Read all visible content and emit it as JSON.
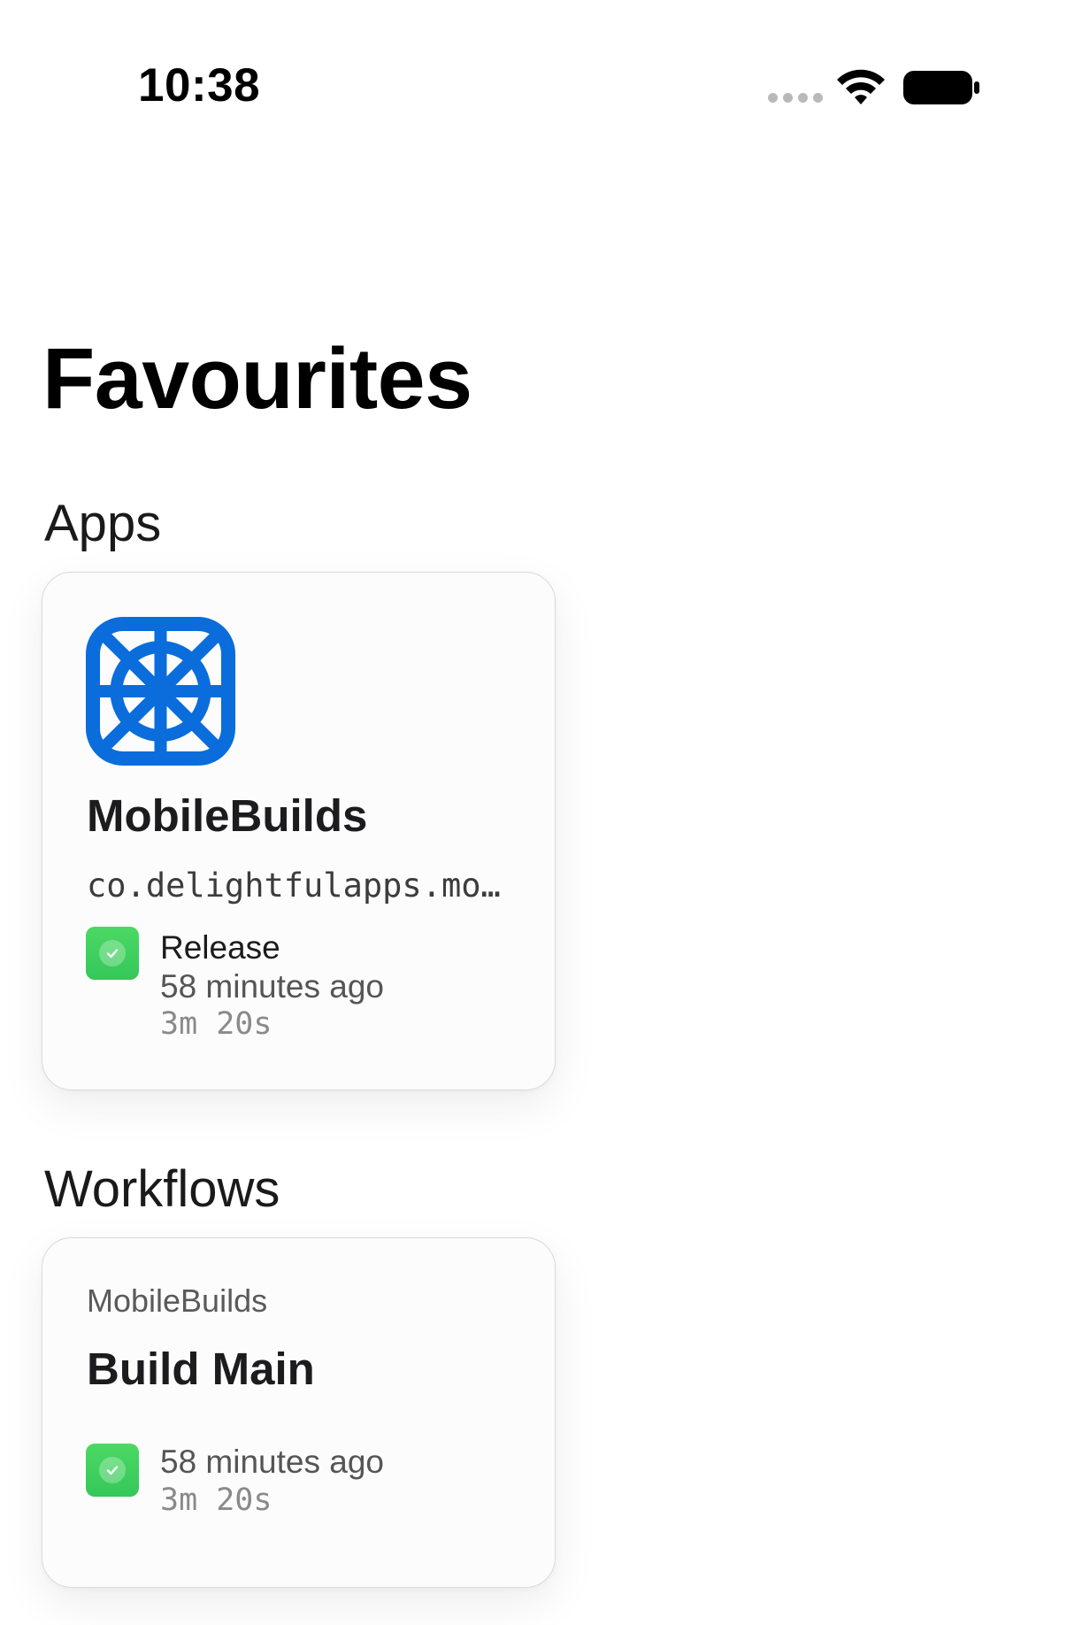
{
  "status_bar": {
    "time": "10:38",
    "icons": [
      "signal-dots-icon",
      "wifi-icon",
      "battery-icon"
    ]
  },
  "page": {
    "title": "Favourites"
  },
  "apps_section": {
    "heading": "Apps",
    "cards": [
      {
        "icon": "app-wheel-icon",
        "icon_color": "#0a6ddb",
        "name": "MobileBuilds",
        "bundle_id": "co.delightfulapps.mo…",
        "last_build": {
          "status": "success",
          "status_color": "#34c759",
          "label": "Release",
          "time_ago": "58 minutes ago",
          "duration": "3m 20s"
        }
      }
    ]
  },
  "workflows_section": {
    "heading": "Workflows",
    "cards": [
      {
        "app_name": "MobileBuilds",
        "name": "Build Main",
        "last_build": {
          "status": "success",
          "status_color": "#34c759",
          "time_ago": "58 minutes ago",
          "duration": "3m 20s"
        }
      }
    ]
  }
}
